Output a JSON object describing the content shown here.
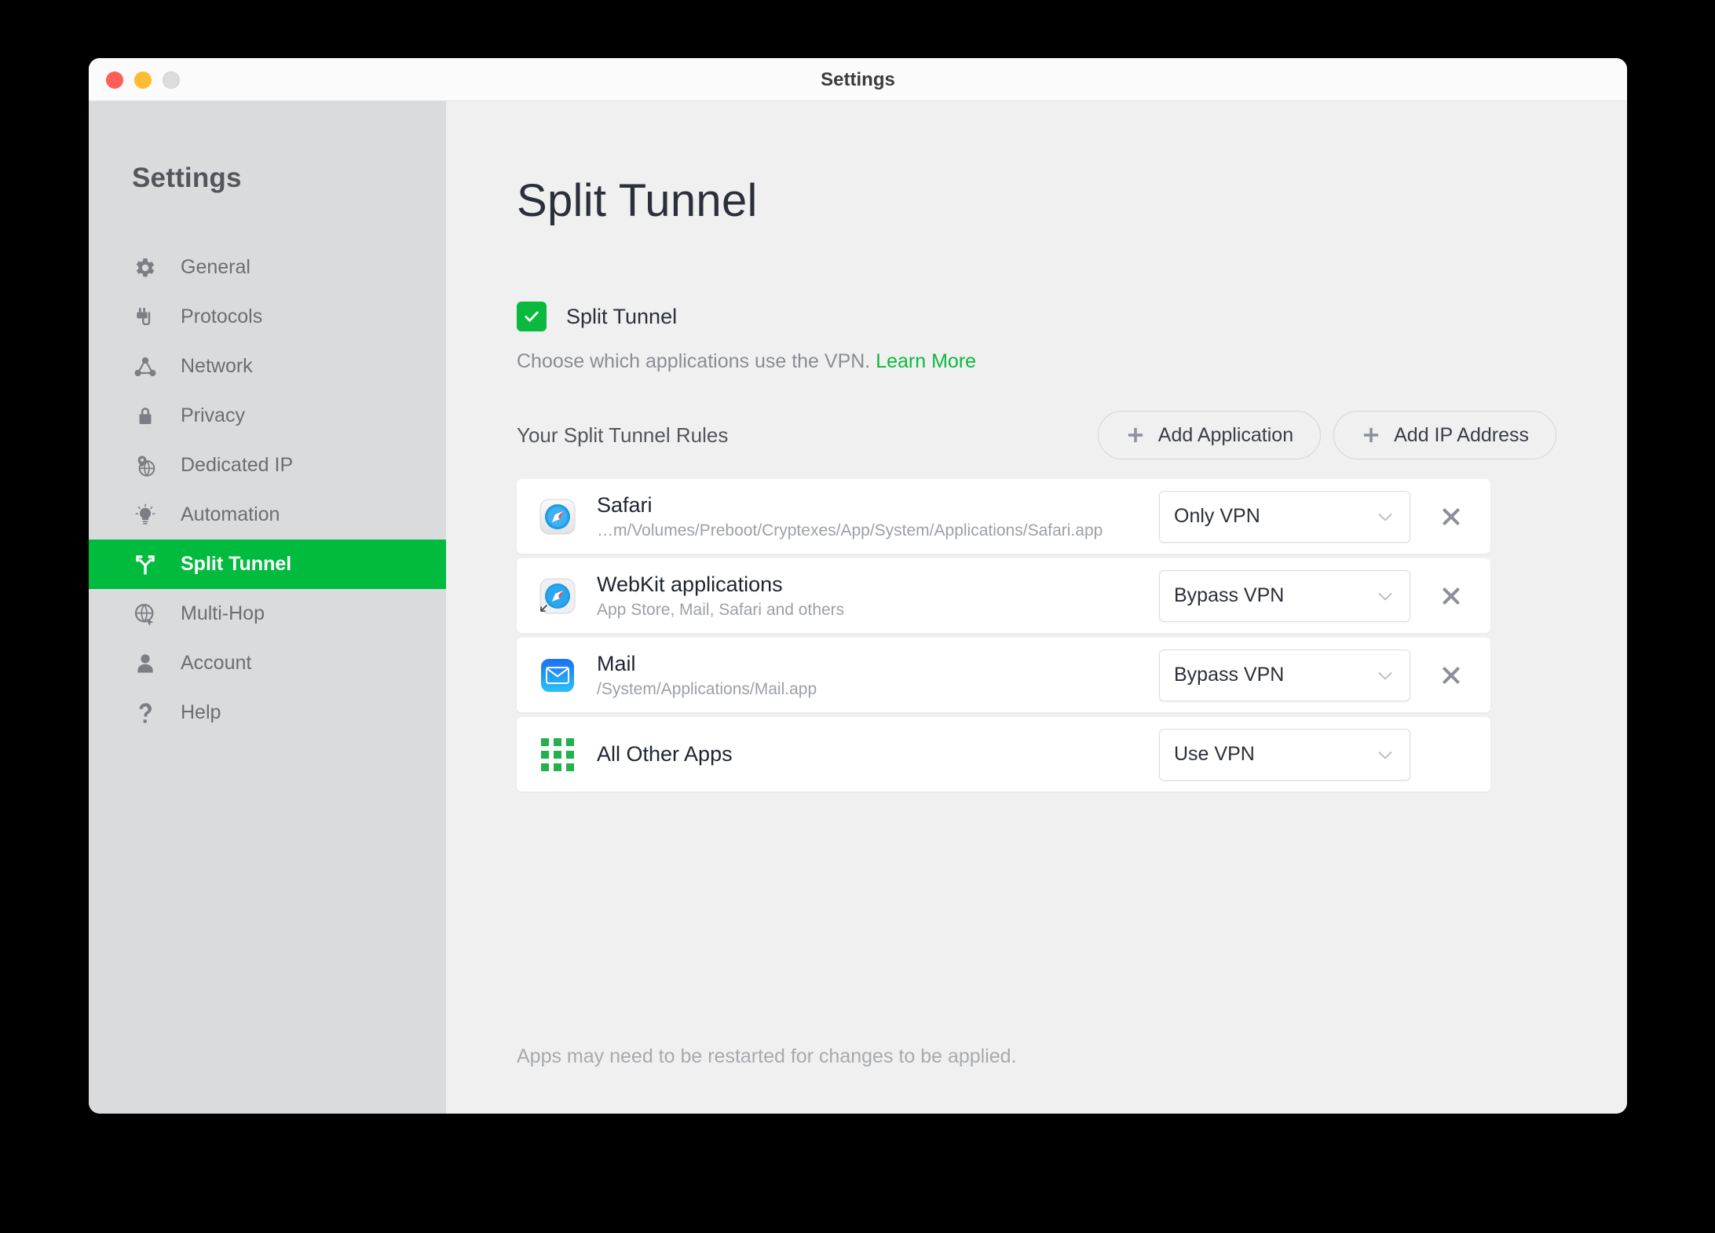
{
  "window": {
    "titlebar_title": "Settings",
    "traffic_lights": [
      "close-red",
      "minimize-yellow",
      "zoom-grey"
    ]
  },
  "sidebar": {
    "heading": "Settings",
    "items": [
      {
        "label": "General",
        "icon": "gear-icon",
        "active": false
      },
      {
        "label": "Protocols",
        "icon": "plug-icon",
        "active": false
      },
      {
        "label": "Network",
        "icon": "network-nodes-icon",
        "active": false
      },
      {
        "label": "Privacy",
        "icon": "lock-icon",
        "active": false
      },
      {
        "label": "Dedicated IP",
        "icon": "pin-globe-icon",
        "active": false
      },
      {
        "label": "Automation",
        "icon": "lightbulb-icon",
        "active": false
      },
      {
        "label": "Split Tunnel",
        "icon": "fork-arrow-icon",
        "active": true
      },
      {
        "label": "Multi-Hop",
        "icon": "globe-arrow-icon",
        "active": false
      },
      {
        "label": "Account",
        "icon": "person-icon",
        "active": false
      },
      {
        "label": "Help",
        "icon": "question-mark-icon",
        "active": false
      }
    ]
  },
  "main": {
    "page_title": "Split Tunnel",
    "toggle": {
      "label": "Split Tunnel",
      "checked": true,
      "icon": "checkmark-icon"
    },
    "description": {
      "text": "Choose which applications use the VPN.",
      "link_label": "Learn More"
    },
    "rules_section": {
      "title": "Your Split Tunnel Rules",
      "add_application_label": "Add Application",
      "add_ip_address_label": "Add IP Address",
      "plus_icon": "plus-icon"
    },
    "rules": [
      {
        "name": "Safari",
        "subtitle": "…m/Volumes/Preboot/Cryptexes/App/System/Applications/Safari.app",
        "icon": "safari-compass-icon",
        "mode": "Only VPN",
        "removable": true,
        "delete_icon": "close-x-icon"
      },
      {
        "name": "WebKit applications",
        "subtitle": "App Store, Mail, Safari and others",
        "icon": "safari-compass-alias-icon",
        "mode": "Bypass VPN",
        "removable": true,
        "delete_icon": "close-x-icon"
      },
      {
        "name": "Mail",
        "subtitle": "/System/Applications/Mail.app",
        "icon": "mail-envelope-icon",
        "mode": "Bypass VPN",
        "removable": true,
        "delete_icon": "close-x-icon"
      },
      {
        "name": "All Other Apps",
        "subtitle": "",
        "icon": "app-grid-icon",
        "mode": "Use VPN",
        "removable": false,
        "delete_icon": ""
      }
    ],
    "footnote": "Apps may need to be restarted for changes to be applied."
  },
  "colors": {
    "accent_green": "#00bb3d",
    "checkbox_green": "#0ab93e",
    "sidebar_bg": "#d9dbdc",
    "content_bg": "#f0f0f0",
    "title_text": "#2b2f3a"
  }
}
